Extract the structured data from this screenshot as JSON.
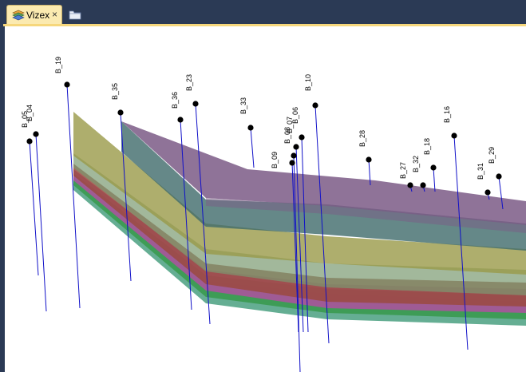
{
  "window": {
    "tab": {
      "label": "Vizex",
      "close_glyph": "×",
      "icon": "layers-icon"
    },
    "new_tab_icon": "folder-icon"
  },
  "viewport": {
    "boreholes": [
      "B_19",
      "B_04",
      "B_05",
      "B_35",
      "B_36",
      "B_23",
      "B_33",
      "B_06",
      "B_07",
      "B_08",
      "B_09",
      "B_10",
      "B_28",
      "B_27",
      "B_18",
      "B_32",
      "B_16",
      "B_31",
      "B_29"
    ],
    "colors": {
      "hole_line": "#1010c8",
      "top_layer": "#7b5b86",
      "layer_teal": "#3e6a6a",
      "layer_olive": "#9a9a48",
      "layer_sage": "#7a9a70",
      "layer_red": "#9a4a40",
      "layer_magenta": "#b050a0",
      "layer_green": "#3a9a50",
      "layer_bottom": "#4aa080"
    }
  }
}
